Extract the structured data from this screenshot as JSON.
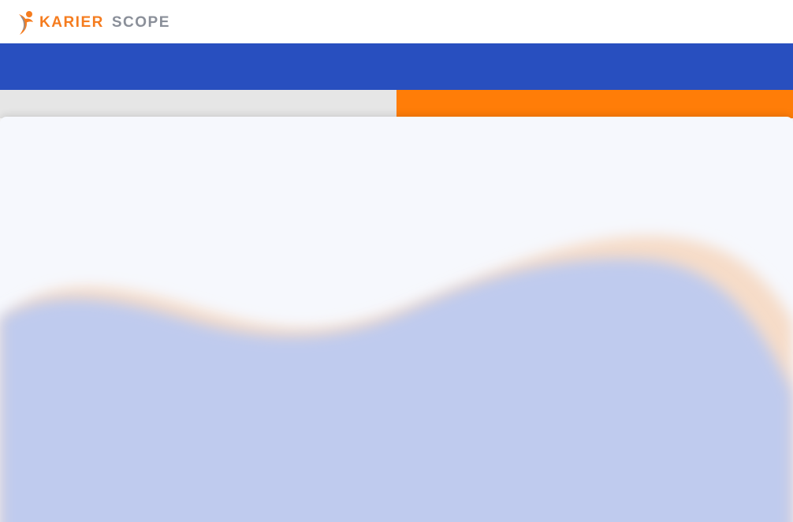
{
  "brand": {
    "name_part1": "KARIER",
    "name_part2": "SCOPE",
    "logo_icon": "person-pin-icon",
    "colors": {
      "orange": "#f57c1f",
      "grey": "#8a8f99"
    }
  },
  "nav": {
    "color": "#284fbf"
  },
  "tabs": {
    "left_color": "#e6e6e6",
    "right_color": "#ff7d08"
  },
  "background": {
    "wave_front_color": "#bfcbee",
    "wave_back_color": "#f6dcc8",
    "page_color": "#f6f8fd"
  }
}
